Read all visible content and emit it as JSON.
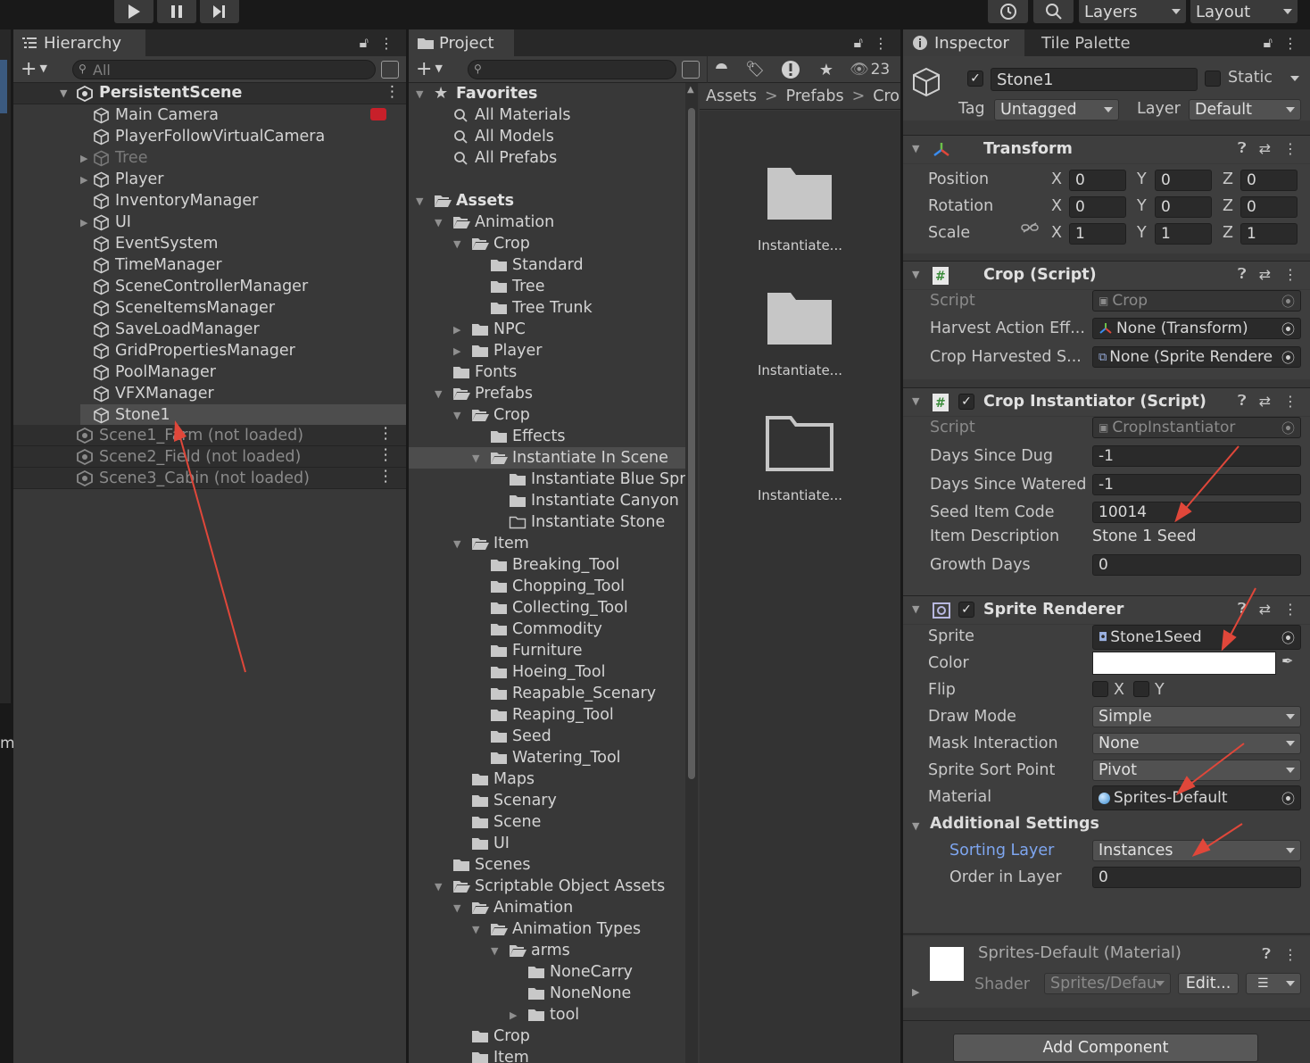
{
  "toolbar": {
    "layers_label": "Layers",
    "layout_label": "Layout"
  },
  "hierarchy": {
    "tab_label": "Hierarchy",
    "search_placeholder": "All",
    "scene_name": "PersistentScene",
    "items": [
      {
        "label": "Main Camera",
        "expandable": false,
        "dim": false
      },
      {
        "label": "PlayerFollowVirtualCamera",
        "expandable": false,
        "dim": false
      },
      {
        "label": "Tree",
        "expandable": true,
        "dim": true
      },
      {
        "label": "Player",
        "expandable": true,
        "dim": false
      },
      {
        "label": "InventoryManager",
        "expandable": false,
        "dim": false
      },
      {
        "label": "UI",
        "expandable": true,
        "dim": false
      },
      {
        "label": "EventSystem",
        "expandable": false,
        "dim": false
      },
      {
        "label": "TimeManager",
        "expandable": false,
        "dim": false
      },
      {
        "label": "SceneControllerManager",
        "expandable": false,
        "dim": false
      },
      {
        "label": "SceneItemsManager",
        "expandable": false,
        "dim": false
      },
      {
        "label": "SaveLoadManager",
        "expandable": false,
        "dim": false
      },
      {
        "label": "GridPropertiesManager",
        "expandable": false,
        "dim": false
      },
      {
        "label": "PoolManager",
        "expandable": false,
        "dim": false
      },
      {
        "label": "VFXManager",
        "expandable": false,
        "dim": false
      },
      {
        "label": "Stone1",
        "expandable": false,
        "dim": false,
        "selected": true
      }
    ],
    "other_scenes": [
      "Scene1_Farm (not loaded)",
      "Scene2_Field (not loaded)",
      "Scene3_Cabin (not loaded)"
    ]
  },
  "project": {
    "tab_label": "Project",
    "hidden_count": "23",
    "breadcrumb": [
      "Assets",
      "Prefabs",
      "Crop"
    ],
    "tree": [
      {
        "label": "Favorites",
        "depth": 0,
        "arrow": "down",
        "icon": "star",
        "bold": true
      },
      {
        "label": "All Materials",
        "depth": 1,
        "arrow": "",
        "icon": "search"
      },
      {
        "label": "All Models",
        "depth": 1,
        "arrow": "",
        "icon": "search"
      },
      {
        "label": "All Prefabs",
        "depth": 1,
        "arrow": "",
        "icon": "search"
      },
      {
        "label": "",
        "depth": 0,
        "arrow": "",
        "icon": "none"
      },
      {
        "label": "Assets",
        "depth": 0,
        "arrow": "down",
        "icon": "folder-open",
        "bold": true
      },
      {
        "label": "Animation",
        "depth": 1,
        "arrow": "down",
        "icon": "folder-open"
      },
      {
        "label": "Crop",
        "depth": 2,
        "arrow": "down",
        "icon": "folder-open"
      },
      {
        "label": "Standard",
        "depth": 3,
        "arrow": "",
        "icon": "folder"
      },
      {
        "label": "Tree",
        "depth": 3,
        "arrow": "",
        "icon": "folder"
      },
      {
        "label": "Tree Trunk",
        "depth": 3,
        "arrow": "",
        "icon": "folder"
      },
      {
        "label": "NPC",
        "depth": 2,
        "arrow": "right",
        "icon": "folder"
      },
      {
        "label": "Player",
        "depth": 2,
        "arrow": "right",
        "icon": "folder"
      },
      {
        "label": "Fonts",
        "depth": 1,
        "arrow": "",
        "icon": "folder"
      },
      {
        "label": "Prefabs",
        "depth": 1,
        "arrow": "down",
        "icon": "folder-open"
      },
      {
        "label": "Crop",
        "depth": 2,
        "arrow": "down",
        "icon": "folder-open"
      },
      {
        "label": "Effects",
        "depth": 3,
        "arrow": "",
        "icon": "folder"
      },
      {
        "label": "Instantiate In Scene",
        "depth": 3,
        "arrow": "down",
        "icon": "folder-open",
        "selected": true
      },
      {
        "label": "Instantiate Blue Spr",
        "depth": 4,
        "arrow": "",
        "icon": "folder"
      },
      {
        "label": "Instantiate Canyon",
        "depth": 4,
        "arrow": "",
        "icon": "folder"
      },
      {
        "label": "Instantiate Stone",
        "depth": 4,
        "arrow": "",
        "icon": "folder-empty"
      },
      {
        "label": "Item",
        "depth": 2,
        "arrow": "down",
        "icon": "folder-open"
      },
      {
        "label": "Breaking_Tool",
        "depth": 3,
        "arrow": "",
        "icon": "folder"
      },
      {
        "label": "Chopping_Tool",
        "depth": 3,
        "arrow": "",
        "icon": "folder"
      },
      {
        "label": "Collecting_Tool",
        "depth": 3,
        "arrow": "",
        "icon": "folder"
      },
      {
        "label": "Commodity",
        "depth": 3,
        "arrow": "",
        "icon": "folder"
      },
      {
        "label": "Furniture",
        "depth": 3,
        "arrow": "",
        "icon": "folder"
      },
      {
        "label": "Hoeing_Tool",
        "depth": 3,
        "arrow": "",
        "icon": "folder"
      },
      {
        "label": "Reapable_Scenary",
        "depth": 3,
        "arrow": "",
        "icon": "folder"
      },
      {
        "label": "Reaping_Tool",
        "depth": 3,
        "arrow": "",
        "icon": "folder"
      },
      {
        "label": "Seed",
        "depth": 3,
        "arrow": "",
        "icon": "folder"
      },
      {
        "label": "Watering_Tool",
        "depth": 3,
        "arrow": "",
        "icon": "folder"
      },
      {
        "label": "Maps",
        "depth": 2,
        "arrow": "",
        "icon": "folder"
      },
      {
        "label": "Scenary",
        "depth": 2,
        "arrow": "",
        "icon": "folder"
      },
      {
        "label": "Scene",
        "depth": 2,
        "arrow": "",
        "icon": "folder"
      },
      {
        "label": "UI",
        "depth": 2,
        "arrow": "",
        "icon": "folder"
      },
      {
        "label": "Scenes",
        "depth": 1,
        "arrow": "",
        "icon": "folder"
      },
      {
        "label": "Scriptable Object Assets",
        "depth": 1,
        "arrow": "down",
        "icon": "folder-open"
      },
      {
        "label": "Animation",
        "depth": 2,
        "arrow": "down",
        "icon": "folder-open"
      },
      {
        "label": "Animation Types",
        "depth": 3,
        "arrow": "down",
        "icon": "folder-open"
      },
      {
        "label": "arms",
        "depth": 4,
        "arrow": "down",
        "icon": "folder-open"
      },
      {
        "label": "NoneCarry",
        "depth": 5,
        "arrow": "",
        "icon": "folder"
      },
      {
        "label": "NoneNone",
        "depth": 5,
        "arrow": "",
        "icon": "folder"
      },
      {
        "label": "tool",
        "depth": 5,
        "arrow": "right",
        "icon": "folder"
      },
      {
        "label": "Crop",
        "depth": 2,
        "arrow": "",
        "icon": "folder"
      },
      {
        "label": "Item",
        "depth": 2,
        "arrow": "",
        "icon": "folder"
      }
    ],
    "grid_items": [
      {
        "label": "Instantiate...",
        "icon": "folder"
      },
      {
        "label": "Instantiate...",
        "icon": "folder"
      },
      {
        "label": "Instantiate...",
        "icon": "folder-empty"
      }
    ]
  },
  "inspector": {
    "tab_label": "Inspector",
    "tab2_label": "Tile Palette",
    "object_name": "Stone1",
    "static_label": "Static",
    "tag_label": "Tag",
    "tag_value": "Untagged",
    "layer_label": "Layer",
    "layer_value": "Default",
    "transform": {
      "title": "Transform",
      "rows": [
        {
          "label": "Position",
          "x": "0",
          "y": "0",
          "z": "0"
        },
        {
          "label": "Rotation",
          "x": "0",
          "y": "0",
          "z": "0"
        },
        {
          "label": "Scale",
          "x": "1",
          "y": "1",
          "z": "1"
        }
      ]
    },
    "crop_script": {
      "title": "Crop (Script)",
      "script_label": "Script",
      "script_value": "Crop",
      "f1_label": "Harvest Action Eff...",
      "f1_value": "None (Transform)",
      "f2_label": "Crop Harvested S...",
      "f2_value": "None (Sprite Rendere"
    },
    "crop_instantiator": {
      "title": "Crop Instantiator (Script)",
      "script_label": "Script",
      "script_value": "CropInstantiator",
      "days_dug_label": "Days Since Dug",
      "days_dug": "-1",
      "days_watered_label": "Days Since Watered",
      "days_watered": "-1",
      "seed_code_label": "Seed Item Code",
      "seed_code": "10014",
      "desc_label": "Item Description",
      "desc": "Stone 1 Seed",
      "growth_label": "Growth Days",
      "growth": "0"
    },
    "sprite_renderer": {
      "title": "Sprite Renderer",
      "sprite_label": "Sprite",
      "sprite": "Stone1Seed",
      "color_label": "Color",
      "color": "#ffffff",
      "flip_label": "Flip",
      "flip_x": "X",
      "flip_y": "Y",
      "draw_mode_label": "Draw Mode",
      "draw_mode": "Simple",
      "mask_label": "Mask Interaction",
      "mask": "None",
      "sort_point_label": "Sprite Sort Point",
      "sort_point": "Pivot",
      "material_label": "Material",
      "material": "Sprites-Default",
      "additional_label": "Additional Settings",
      "sorting_layer_label": "Sorting Layer",
      "sorting_layer": "Instances",
      "order_label": "Order in Layer",
      "order": "0"
    },
    "material": {
      "title": "Sprites-Default (Material)",
      "shader_label": "Shader",
      "shader": "Sprites/Defau",
      "edit_label": "Edit..."
    },
    "add_component_label": "Add Component"
  },
  "edge_letter": "m"
}
